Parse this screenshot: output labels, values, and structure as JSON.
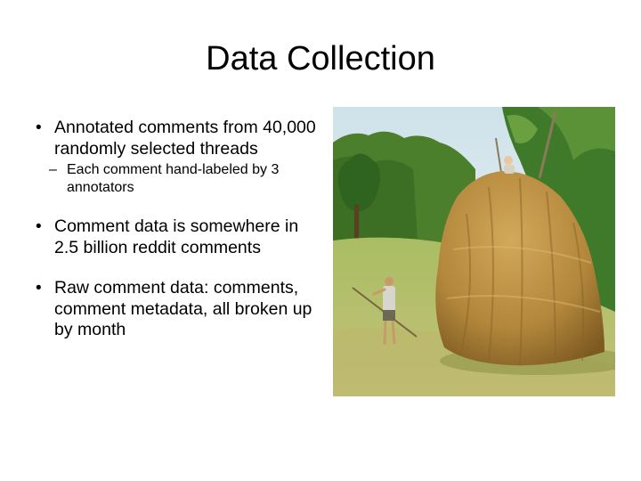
{
  "slide": {
    "title": "Data Collection",
    "bullets": [
      {
        "text": "Annotated comments from 40,000 randomly selected threads",
        "subitems": [
          "Each comment hand-labeled by 3 annotators"
        ]
      },
      {
        "text": "Comment data is somewhere in 2.5 billion reddit comments"
      },
      {
        "text": "Raw comment data: comments, comment metadata, all broken up by month"
      }
    ],
    "bullet_marker": "•",
    "sub_marker": "–"
  },
  "photo": {
    "subject": "haystack-photo"
  },
  "colors": {
    "background": "#ffffff",
    "text": "#000000",
    "sky": "#dce9ee",
    "hay": "#b88a3c",
    "grass": "#9cb45a",
    "trees": "#3f7a2a"
  }
}
